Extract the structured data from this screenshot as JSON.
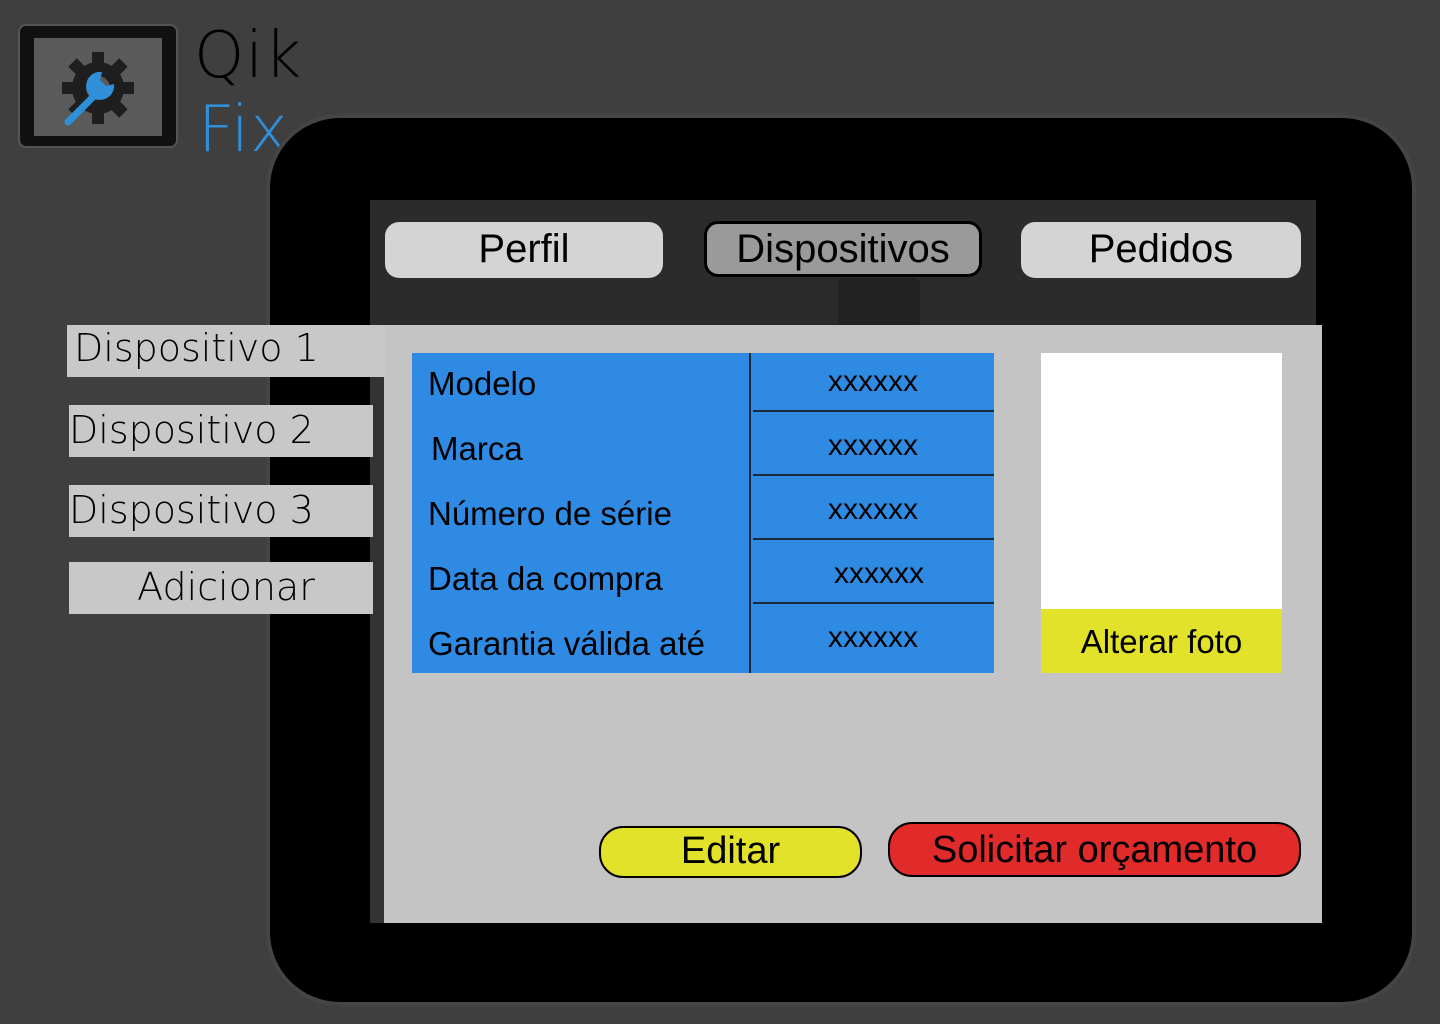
{
  "logo": {
    "line1": "Qik",
    "line2": "Fix",
    "icon": "gear-wrench-icon",
    "accent": "#2f8fd8"
  },
  "tabs": [
    {
      "label": "Perfil",
      "active": false
    },
    {
      "label": "Dispositivos",
      "active": true
    },
    {
      "label": "Pedidos",
      "active": false
    }
  ],
  "sidebar": {
    "items": [
      {
        "label": "Dispositivo 1",
        "selected": true
      },
      {
        "label": "Dispositivo 2",
        "selected": false
      },
      {
        "label": "Dispositivo 3",
        "selected": false
      }
    ],
    "add_label": "Adicionar"
  },
  "device_info": {
    "rows": [
      {
        "label": "Modelo",
        "value": "xxxxxx"
      },
      {
        "label": "Marca",
        "value": "xxxxxx"
      },
      {
        "label": "Número de série",
        "value": "xxxxxx"
      },
      {
        "label": "Data da compra",
        "value": "xxxxxx"
      },
      {
        "label": "Garantia válida até",
        "value": "xxxxxx"
      }
    ]
  },
  "photo": {
    "change_label": "Alterar foto"
  },
  "actions": {
    "edit_label": "Editar",
    "quote_label": "Solicitar orçamento"
  },
  "colors": {
    "background": "#3f3f3f",
    "table_blue": "#2f8ae3",
    "yellow": "#e2e22a",
    "red": "#e12a2a",
    "panel": "#c4c4c4"
  }
}
